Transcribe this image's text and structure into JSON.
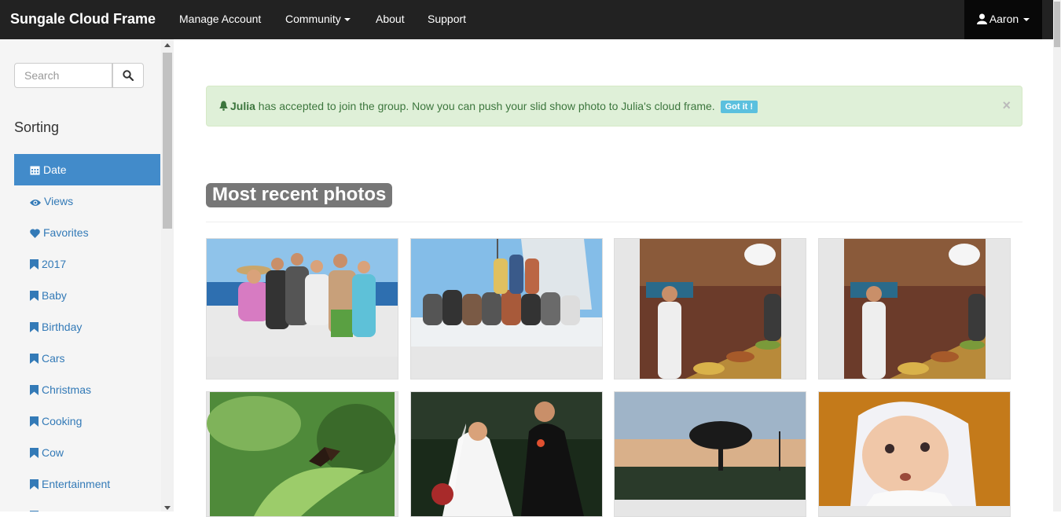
{
  "navbar": {
    "brand": "Sungale Cloud Frame",
    "links": [
      "Manage Account",
      "Community",
      "About",
      "Support"
    ],
    "user": "Aaron"
  },
  "sidebar": {
    "search_placeholder": "Search",
    "sorting_title": "Sorting",
    "items": [
      {
        "label": "Date",
        "icon": "calendar-icon",
        "active": true
      },
      {
        "label": "Views",
        "icon": "eye-icon"
      },
      {
        "label": "Favorites",
        "icon": "heart-icon"
      },
      {
        "label": "2017",
        "icon": "bookmark-icon"
      },
      {
        "label": "Baby",
        "icon": "bookmark-icon"
      },
      {
        "label": "Birthday",
        "icon": "bookmark-icon"
      },
      {
        "label": "Cars",
        "icon": "bookmark-icon"
      },
      {
        "label": "Christmas",
        "icon": "bookmark-icon"
      },
      {
        "label": "Cooking",
        "icon": "bookmark-icon"
      },
      {
        "label": "Cow",
        "icon": "bookmark-icon"
      },
      {
        "label": "Entertainment",
        "icon": "bookmark-icon"
      }
    ]
  },
  "alert": {
    "name": "Julia",
    "message": "has accepted to join the group. Now you can push your slid show photo to Julia's cloud frame.",
    "button": "Got it !",
    "close": "×"
  },
  "main": {
    "section_title": "Most recent photos"
  },
  "photos": [
    {
      "subject": "group-on-boat-photo"
    },
    {
      "subject": "sailboat-group-photo"
    },
    {
      "subject": "market-food-stall-photo"
    },
    {
      "subject": "market-food-stall-photo"
    },
    {
      "subject": "butterfly-leaf-photo"
    },
    {
      "subject": "wedding-couple-photo"
    },
    {
      "subject": "sunset-tree-photo"
    },
    {
      "subject": "baby-portrait-photo"
    }
  ],
  "colors": {
    "navbar": "#222222",
    "active_item": "#428bca",
    "link": "#337ab7",
    "alert_bg": "#dff0d8",
    "alert_text": "#3c763d",
    "badge": "#5bc0de"
  }
}
